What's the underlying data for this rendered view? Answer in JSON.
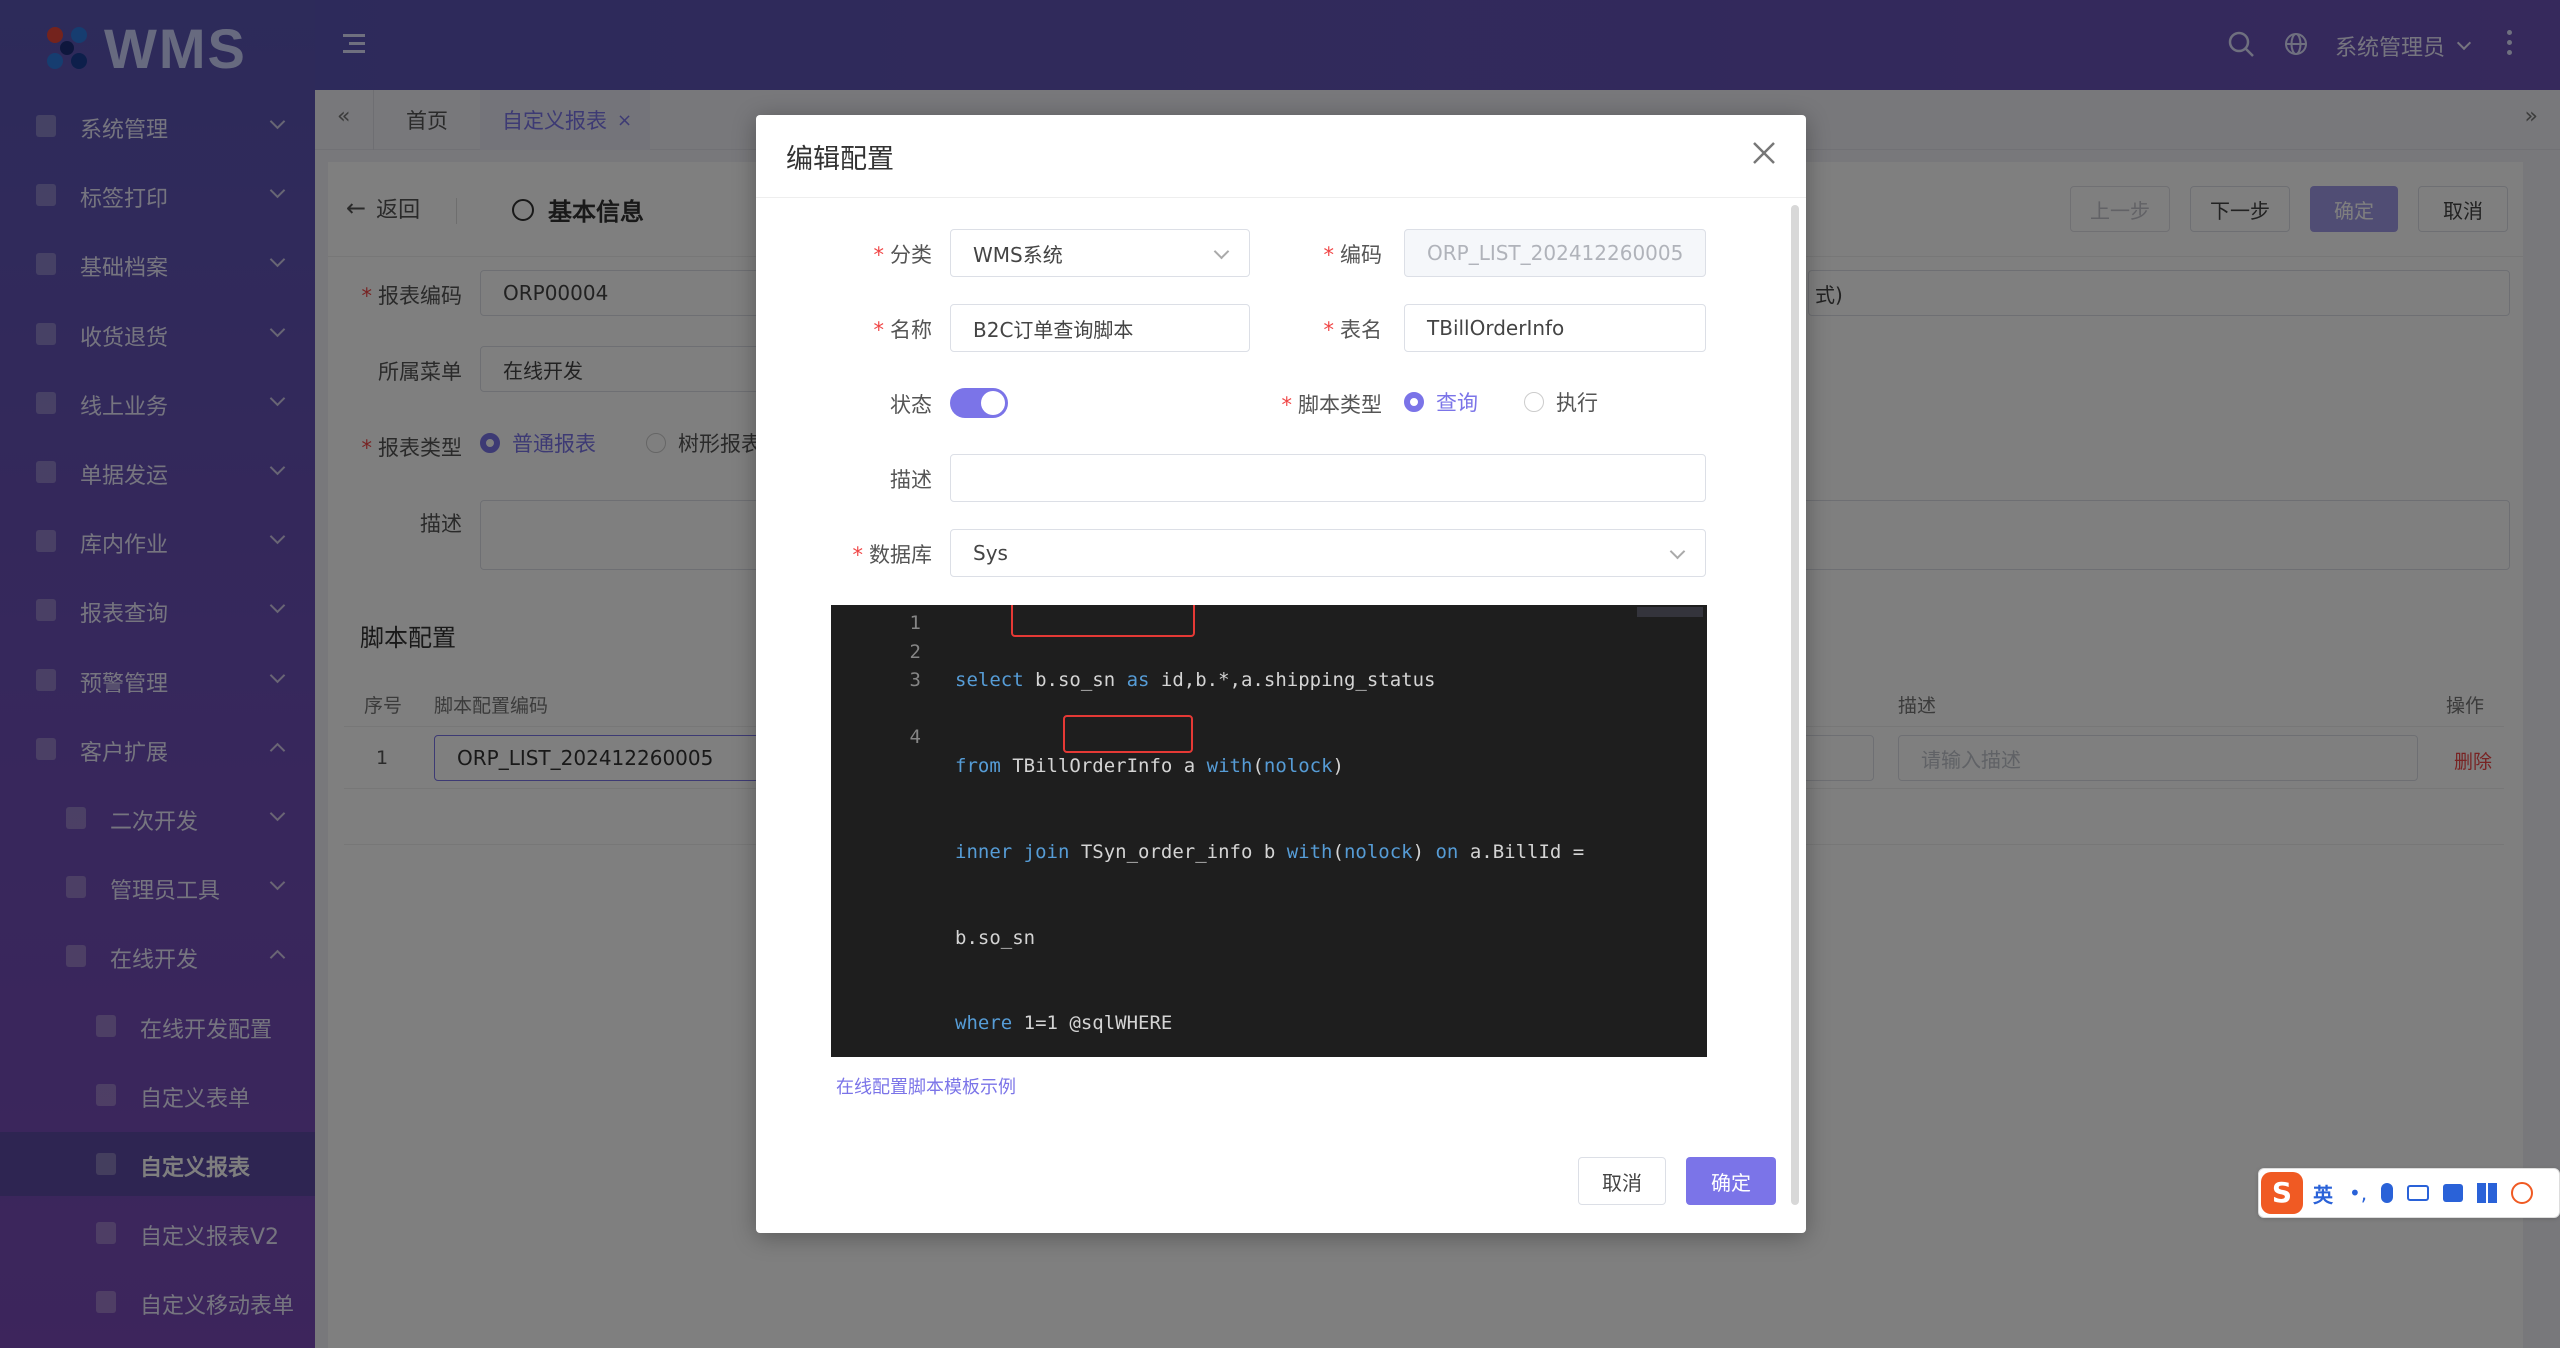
{
  "app": {
    "logo_text": "WMS",
    "user_label": "系统管理员",
    "colors": {
      "accent": "#7b74e8",
      "sidebar_top": "#5a56b5",
      "sidebar_bottom": "#7a4bb8",
      "danger": "#f04646"
    }
  },
  "sidebar": {
    "items": [
      {
        "label": "系统管理",
        "level": 0,
        "arrow": "down"
      },
      {
        "label": "标签打印",
        "level": 0,
        "arrow": "down"
      },
      {
        "label": "基础档案",
        "level": 0,
        "arrow": "down"
      },
      {
        "label": "收货退货",
        "level": 0,
        "arrow": "down"
      },
      {
        "label": "线上业务",
        "level": 0,
        "arrow": "down"
      },
      {
        "label": "单据发运",
        "level": 0,
        "arrow": "down"
      },
      {
        "label": "库内作业",
        "level": 0,
        "arrow": "down"
      },
      {
        "label": "报表查询",
        "level": 0,
        "arrow": "down"
      },
      {
        "label": "预警管理",
        "level": 0,
        "arrow": "down"
      },
      {
        "label": "客户扩展",
        "level": 0,
        "arrow": "up"
      },
      {
        "label": "二次开发",
        "level": 1,
        "arrow": "down"
      },
      {
        "label": "管理员工具",
        "level": 1,
        "arrow": "down"
      },
      {
        "label": "在线开发",
        "level": 1,
        "arrow": "up"
      },
      {
        "label": "在线开发配置",
        "level": 2,
        "arrow": ""
      },
      {
        "label": "自定义表单",
        "level": 2,
        "arrow": ""
      },
      {
        "label": "自定义报表",
        "level": 2,
        "arrow": "",
        "active": true
      },
      {
        "label": "自定义报表V2",
        "level": 2,
        "arrow": ""
      },
      {
        "label": "自定义移动表单",
        "level": 2,
        "arrow": ""
      }
    ]
  },
  "tabs": {
    "home": "首页",
    "current": "自定义报表"
  },
  "page": {
    "back_label": "返回",
    "section_title": "基本信息",
    "prev_label": "上一步",
    "next_label": "下一步",
    "confirm_label": "确定",
    "cancel_label": "取消",
    "report_code_label": "报表编码",
    "report_code_value": "ORP00004",
    "menu_label": "所属菜单",
    "menu_value": "在线开发",
    "report_type_label": "报表类型",
    "report_type_opt1": "普通报表",
    "report_type_opt2": "树形报表",
    "desc_label": "描述",
    "right_input_tail": "式)",
    "script_section": "脚本配置",
    "table_headers": {
      "index": "序号",
      "code": "脚本配置编码",
      "desc": "描述",
      "ops": "操作"
    },
    "row": {
      "index": "1",
      "code": "ORP_LIST_202412260005",
      "desc_placeholder": "请输入描述",
      "delete": "删除"
    }
  },
  "modal": {
    "title": "编辑配置",
    "category_label": "分类",
    "category_value": "WMS系统",
    "code_label": "编码",
    "code_value": "ORP_LIST_202412260005",
    "name_label": "名称",
    "name_value": "B2C订单查询脚本",
    "table_label": "表名",
    "table_value": "TBillOrderInfo",
    "status_label": "状态",
    "status_on": true,
    "script_type_label": "脚本类型",
    "script_type_opt1": "查询",
    "script_type_opt2": "执行",
    "desc_label": "描述",
    "db_label": "数据库",
    "db_value": "Sys",
    "template_link": "在线配置脚本模板示例",
    "cancel_label": "取消",
    "confirm_label": "确定",
    "code_lines": [
      "1",
      "2",
      "3",
      "4"
    ]
  },
  "ime": {
    "lang": "英"
  }
}
